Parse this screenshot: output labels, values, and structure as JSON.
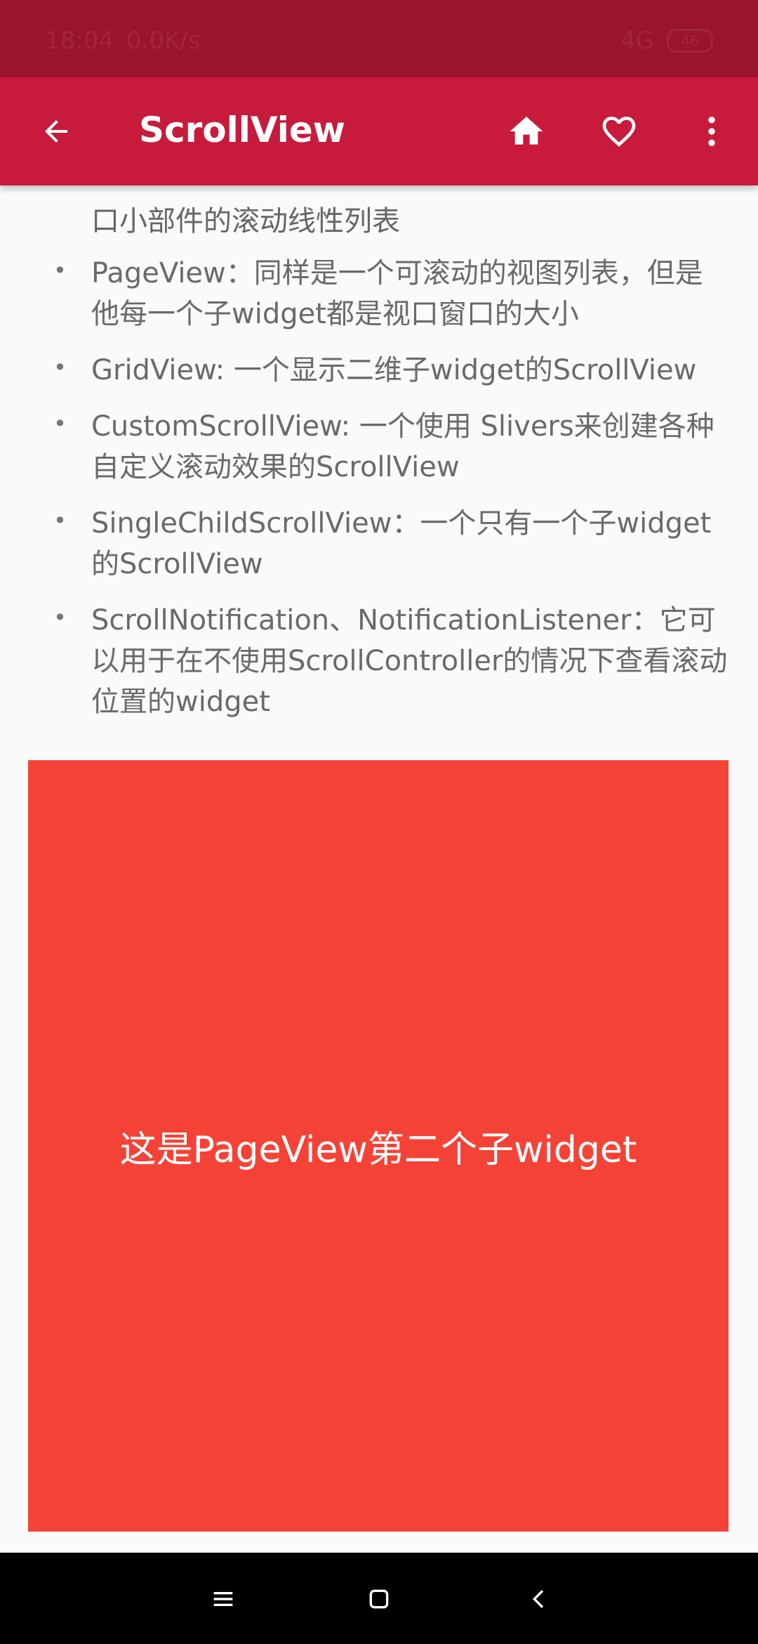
{
  "status_bar": {
    "time": "18:04",
    "network_speed": "0.0K/s",
    "signal": "4G",
    "battery": "46"
  },
  "app_bar": {
    "title": "ScrollView",
    "icons": [
      "arrow-back-icon",
      "home-icon",
      "heart-icon",
      "more-vert-icon"
    ]
  },
  "content": {
    "top_fragment": "口小部件的滚动线性列表",
    "bullets": [
      "PageView：同样是一个可滚动的视图列表，但是他每一个子widget都是视口窗口的大小",
      "GridView: 一个显示二维子widget的ScrollView",
      "CustomScrollView: 一个使用 Slivers来创建各种自定义滚动效果的ScrollView",
      "SingleChildScrollView：一个只有一个子widget的ScrollView",
      "ScrollNotification、NotificationListener：它可以用于在不使用ScrollController的情况下查看滚动位置的widget"
    ],
    "page_view_text": "这是PageView第二个子widget",
    "page_view_color": "#f44336"
  },
  "colors": {
    "status_bar": "#9a142c",
    "app_bar": "#c81a3b",
    "background": "#fafafa"
  },
  "nav_bar": {
    "icons": [
      "menu-icon",
      "square-home-icon",
      "chevron-back-icon"
    ]
  }
}
